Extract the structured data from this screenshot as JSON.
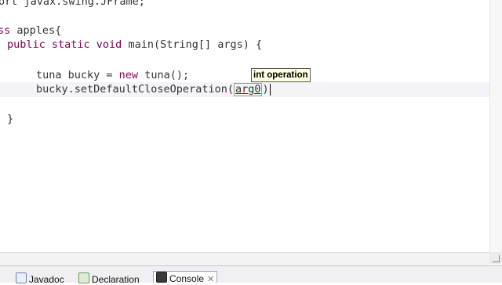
{
  "editor": {
    "lines": {
      "l1": "ort javax.swing.JFrame;",
      "l2_kw": "ss",
      "l2_rest": " apples{",
      "l3_kw": "public static void",
      "l3_rest": " main(String[] args) {",
      "l4_a": "tuna bucky = ",
      "l4_kw": "new",
      "l4_b": " tuna();",
      "l5_a": "bucky.setDefaultCloseOperation(",
      "l5_arg": "arg0",
      "l5_b": ")",
      "l6": "}"
    },
    "tooltip": "int operation"
  },
  "bottom_tabs": [
    {
      "label": "Javadoc",
      "icon": "javadoc-icon"
    },
    {
      "label": "Declaration",
      "icon": "declaration-icon"
    },
    {
      "label": "Console",
      "icon": "console-icon",
      "active": true
    }
  ],
  "colors": {
    "keyword": "#7f0055",
    "tooltip_bg": "#ffffe1"
  }
}
